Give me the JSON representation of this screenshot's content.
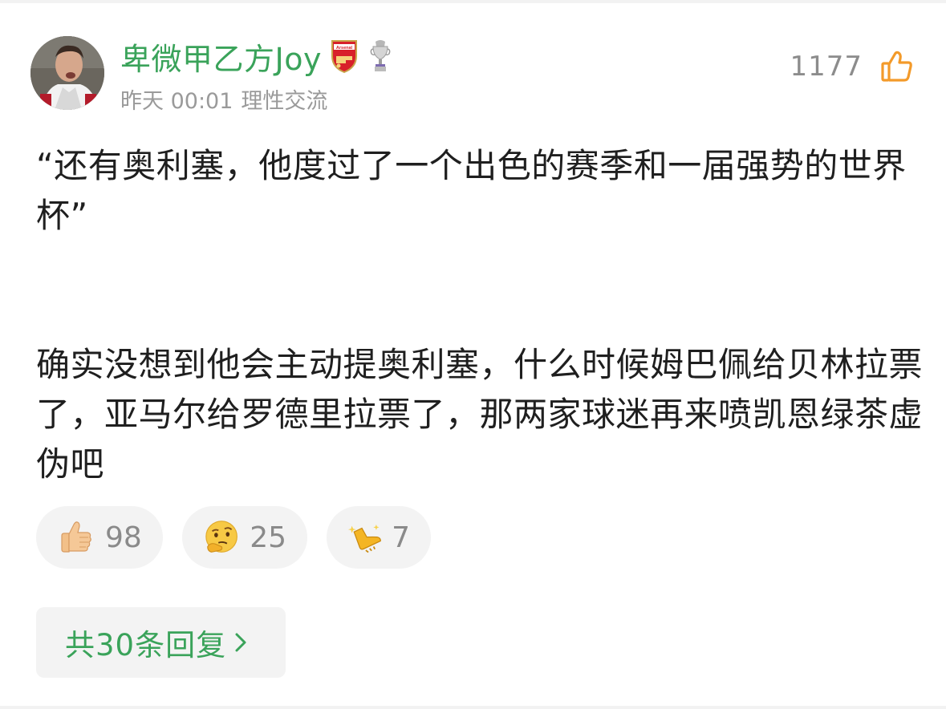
{
  "comment": {
    "username": "卑微甲乙方Joy",
    "badges": [
      "arsenal-badge-icon",
      "premier-league-trophy-icon"
    ],
    "badge_text": "Arsenal",
    "date": "昨天 00:01",
    "tag": "理性交流",
    "likes": "1177",
    "body": {
      "paragraph1": "“还有奥利塞，他度过了一个出色的赛季和一届强势的世界杯”",
      "paragraph2": "确实没想到他会主动提奥利塞，什么时候姆巴佩给贝林拉票了，亚马尔给罗德里拉票了，那两家球迷再来喷凯恩绿茶虚伪吧"
    },
    "reactions": [
      {
        "icon": "thumbs-up-emoji",
        "count": "98"
      },
      {
        "icon": "thinking-face-emoji",
        "count": "25"
      },
      {
        "icon": "golden-boot-emoji",
        "count": "7"
      }
    ],
    "reply_label": "共30条回复"
  },
  "colors": {
    "accent_green": "#3aa35a",
    "like_orange": "#f39a2a",
    "meta_gray": "#9a9a9a",
    "pill_bg": "#f3f3f3"
  }
}
